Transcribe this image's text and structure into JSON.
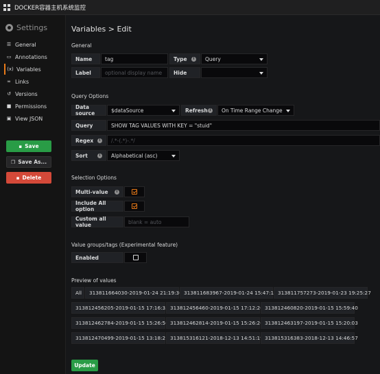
{
  "app": {
    "title": "DOCKER容器主机系统监控"
  },
  "sidebar": {
    "title": "Settings",
    "items": [
      {
        "label": "General",
        "icon": "sliders-icon"
      },
      {
        "label": "Annotations",
        "icon": "comment-icon"
      },
      {
        "label": "Variables",
        "icon": "variable-icon"
      },
      {
        "label": "Links",
        "icon": "link-icon"
      },
      {
        "label": "Versions",
        "icon": "history-icon"
      },
      {
        "label": "Permissions",
        "icon": "lock-icon"
      },
      {
        "label": "View JSON",
        "icon": "code-icon"
      }
    ],
    "active_item": "Variables",
    "save_label": "Save",
    "save_as_label": "Save As...",
    "delete_label": "Delete"
  },
  "page": {
    "title": "Variables > Edit"
  },
  "general": {
    "section": "General",
    "name_label": "Name",
    "name_value": "tag",
    "type_label": "Type",
    "type_value": "Query",
    "label_label": "Label",
    "label_placeholder": "optional display name",
    "hide_label": "Hide",
    "hide_value": ""
  },
  "query_options": {
    "section": "Query Options",
    "datasource_label": "Data source",
    "datasource_value": "$dataSource",
    "refresh_label": "Refresh",
    "refresh_value": "On Time Range Change",
    "query_label": "Query",
    "query_value": "SHOW TAG VALUES WITH KEY = \"stuid\"",
    "regex_label": "Regex",
    "regex_placeholder": "/.*-(.*)-.*/",
    "sort_label": "Sort",
    "sort_value": "Alphabetical (asc)"
  },
  "selection_options": {
    "section": "Selection Options",
    "multi_label": "Multi-value",
    "multi_checked": true,
    "include_all_label": "Include All option",
    "include_all_checked": true,
    "custom_all_label": "Custom all value",
    "custom_all_placeholder": "blank = auto"
  },
  "value_groups": {
    "section": "Value groups/tags (Experimental feature)",
    "enabled_label": "Enabled",
    "enabled_checked": false
  },
  "preview": {
    "section": "Preview of values",
    "values": [
      "All",
      "313811664030-2019-01-24 21:19:30",
      "313811683967-2019-01-24 15:47:13",
      "313811757273-2019-01-23 19:25:27",
      "313812456205-2019-01-15 17:16:35",
      "313812456460-2019-01-15 17:12:20",
      "313812460820-2019-01-15 15:59:40",
      "313812462784-2019-01-15 15:26:56",
      "313812462814-2019-01-15 15:26:26",
      "313812463197-2019-01-15 15:20:03",
      "313812470499-2019-01-15 13:18:21",
      "313815316121-2018-12-13 14:51:19",
      "313815316383-2018-12-13 14:46:57"
    ]
  },
  "update_label": "Update",
  "colors": {
    "accent": "#eb7b18",
    "success": "#299c46",
    "danger": "#d44939"
  }
}
